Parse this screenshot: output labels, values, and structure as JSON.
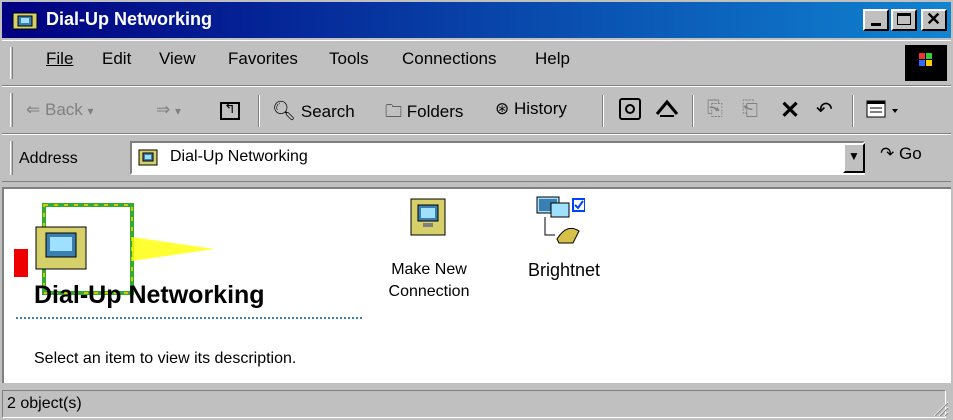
{
  "window": {
    "title": "Dial-Up Networking"
  },
  "menu": {
    "file": "File",
    "edit": "Edit",
    "view": "View",
    "favorites": "Favorites",
    "tools": "Tools",
    "connections": "Connections",
    "help": "Help"
  },
  "toolbar": {
    "back": "Back",
    "search": "Search",
    "folders": "Folders",
    "history": "History"
  },
  "address": {
    "label": "Address",
    "value": "Dial-Up Networking",
    "go": "Go"
  },
  "content": {
    "banner_title": "Dial-Up Networking",
    "description": "Select an item to view its description.",
    "items": [
      {
        "label_line1": "Make New",
        "label_line2": "Connection"
      },
      {
        "label_line1": "Brightnet",
        "label_line2": ""
      }
    ]
  },
  "status": {
    "text": "2 object(s)"
  },
  "icons": {
    "window": "dialup-folder-icon",
    "make_new": "make-new-connection-icon",
    "connection": "brightnet-connection-icon"
  }
}
